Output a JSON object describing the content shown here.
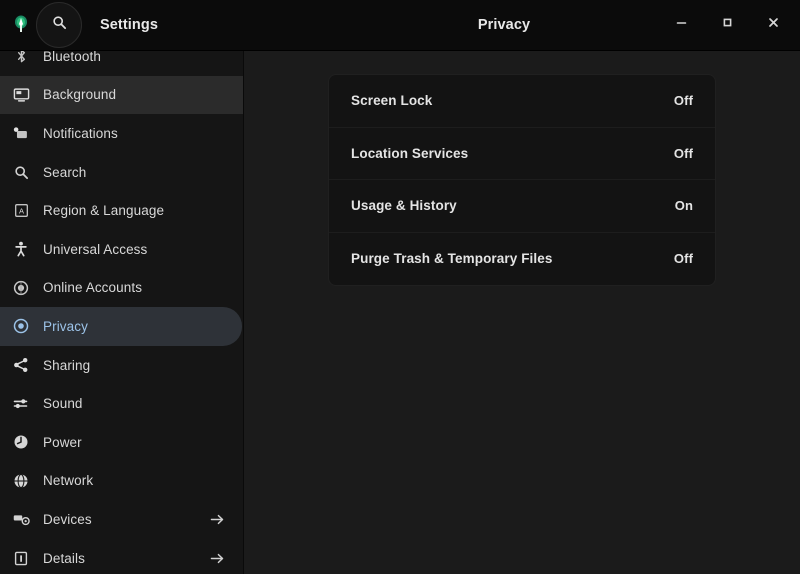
{
  "header": {
    "app_logo_icon": "app-logo-icon",
    "search_icon": "search-icon",
    "settings_title": "Settings",
    "panel_title": "Privacy",
    "minimize_label": "–",
    "maximize_label": "□",
    "close_label": "✕",
    "minimize_icon": "minimize-icon",
    "maximize_icon": "maximize-icon",
    "close_icon": "close-icon"
  },
  "sidebar": {
    "items": [
      {
        "label": "Bluetooth",
        "icon": "bluetooth-icon",
        "state": "clipped",
        "arrow": ""
      },
      {
        "label": "Background",
        "icon": "monitor-icon",
        "state": "hovered",
        "arrow": ""
      },
      {
        "label": "Notifications",
        "icon": "notifications-icon",
        "state": "normal",
        "arrow": ""
      },
      {
        "label": "Search",
        "icon": "search-icon",
        "state": "normal",
        "arrow": ""
      },
      {
        "label": "Region & Language",
        "icon": "region-language-icon",
        "state": "normal",
        "arrow": ""
      },
      {
        "label": "Universal Access",
        "icon": "universal-access-icon",
        "state": "normal",
        "arrow": ""
      },
      {
        "label": "Online Accounts",
        "icon": "online-accounts-icon",
        "state": "normal",
        "arrow": ""
      },
      {
        "label": "Privacy",
        "icon": "privacy-icon",
        "state": "selected",
        "arrow": ""
      },
      {
        "label": "Sharing",
        "icon": "sharing-icon",
        "state": "normal",
        "arrow": ""
      },
      {
        "label": "Sound",
        "icon": "sound-icon",
        "state": "normal",
        "arrow": ""
      },
      {
        "label": "Power",
        "icon": "power-icon",
        "state": "normal",
        "arrow": ""
      },
      {
        "label": "Network",
        "icon": "network-icon",
        "state": "normal",
        "arrow": ""
      },
      {
        "label": "Devices",
        "icon": "devices-icon",
        "state": "normal",
        "arrow": "→"
      },
      {
        "label": "Details",
        "icon": "details-icon",
        "state": "normal",
        "arrow": "→"
      }
    ]
  },
  "main": {
    "rows": [
      {
        "label": "Screen Lock",
        "value": "Off"
      },
      {
        "label": "Location Services",
        "value": "Off"
      },
      {
        "label": "Usage & History",
        "value": "On"
      },
      {
        "label": "Purge Trash & Temporary Files",
        "value": "Off"
      }
    ]
  },
  "colors": {
    "window_bg": "#1b1b1b",
    "titlebar_bg": "#0b0b0b",
    "sidebar_bg": "#151515",
    "card_bg": "#131313",
    "selected_bg": "#2e3238",
    "selected_text": "#9cc3e8",
    "hover_bg": "#2b2b2b",
    "text_primary": "#e4e4e4",
    "logo_green": "#2ec27e"
  }
}
